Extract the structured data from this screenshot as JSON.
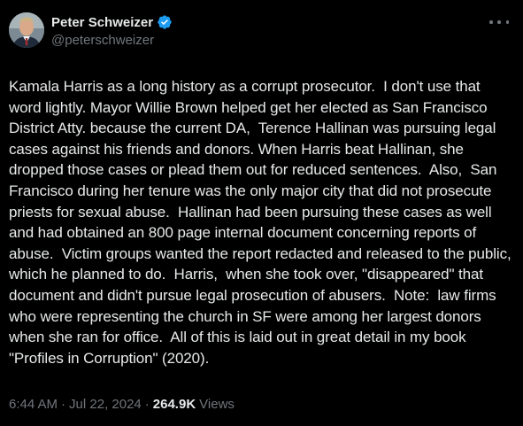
{
  "author": {
    "display_name": "Peter Schweizer",
    "handle": "@peterschweizer",
    "verified": true,
    "verified_color": "#1d9bf0",
    "avatar_icon": "avatar-photo"
  },
  "more_icon": "ellipsis-icon",
  "tweet": {
    "text": "Kamala Harris as a long history as a corrupt prosecutor.  I don't use that word lightly. Mayor Willie Brown helped get her elected as San Francisco District Atty. because the current DA,  Terence Hallinan was pursuing legal cases against his friends and donors. When Harris beat Hallinan, she dropped those cases or plead them out for reduced sentences.  Also,  San Francisco during her tenure was the only major city that did not prosecute priests for sexual abuse.  Hallinan had been pursuing these cases as well and had obtained an 800 page internal document concerning reports of abuse.  Victim groups wanted the report redacted and released to the public,  which he planned to do.  Harris,  when she took over, \"disappeared\" that document and didn't pursue legal prosecution of abusers.  Note:  law firms who were representing the church in SF were among her largest donors when she ran for office.  All of this is laid out in great detail in my book \"Profiles in Corruption\" (2020)."
  },
  "meta": {
    "time": "6:44 AM",
    "separator": "·",
    "date": "Jul 22, 2024",
    "views_count": "264.9K",
    "views_label": "Views"
  },
  "colors": {
    "background": "#000000",
    "text": "#e7e9ea",
    "secondary": "#71767b"
  }
}
